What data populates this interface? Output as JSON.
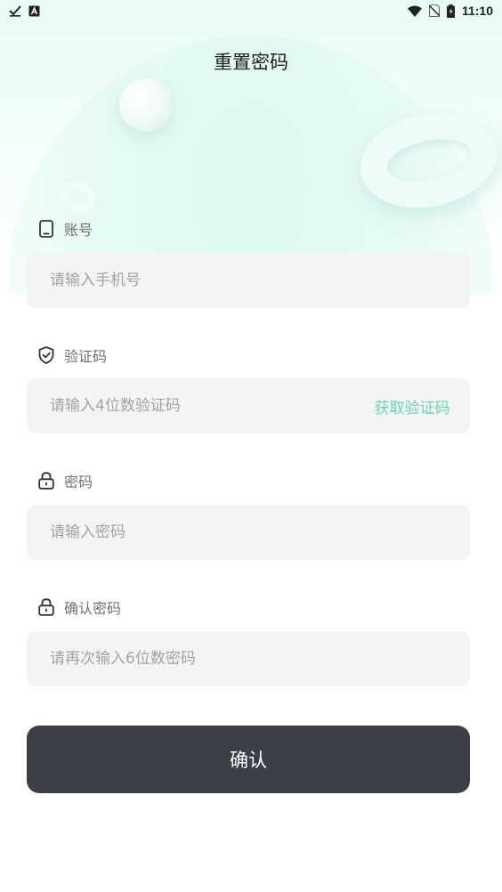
{
  "status_bar": {
    "time": "11:10",
    "left_icons": [
      "check-icon",
      "a-icon"
    ],
    "right_icons": [
      "wifi-icon",
      "no-sim-icon",
      "battery-icon"
    ]
  },
  "page": {
    "title": "重置密码"
  },
  "form": {
    "account": {
      "label": "账号",
      "icon": "phone-icon",
      "placeholder": "请输入手机号",
      "value": ""
    },
    "code": {
      "label": "验证码",
      "icon": "shield-check-icon",
      "placeholder": "请输入4位数验证码",
      "value": "",
      "action_label": "获取验证码"
    },
    "password": {
      "label": "密码",
      "icon": "lock-icon",
      "placeholder": "请输入密码",
      "value": ""
    },
    "confirm_password": {
      "label": "确认密码",
      "icon": "lock-icon",
      "placeholder": "请再次输入6位数密码",
      "value": ""
    }
  },
  "actions": {
    "confirm_label": "确认"
  },
  "colors": {
    "accent": "#6cd0b5",
    "button_bg": "#3b3f48",
    "input_bg": "#f4f4f4"
  }
}
